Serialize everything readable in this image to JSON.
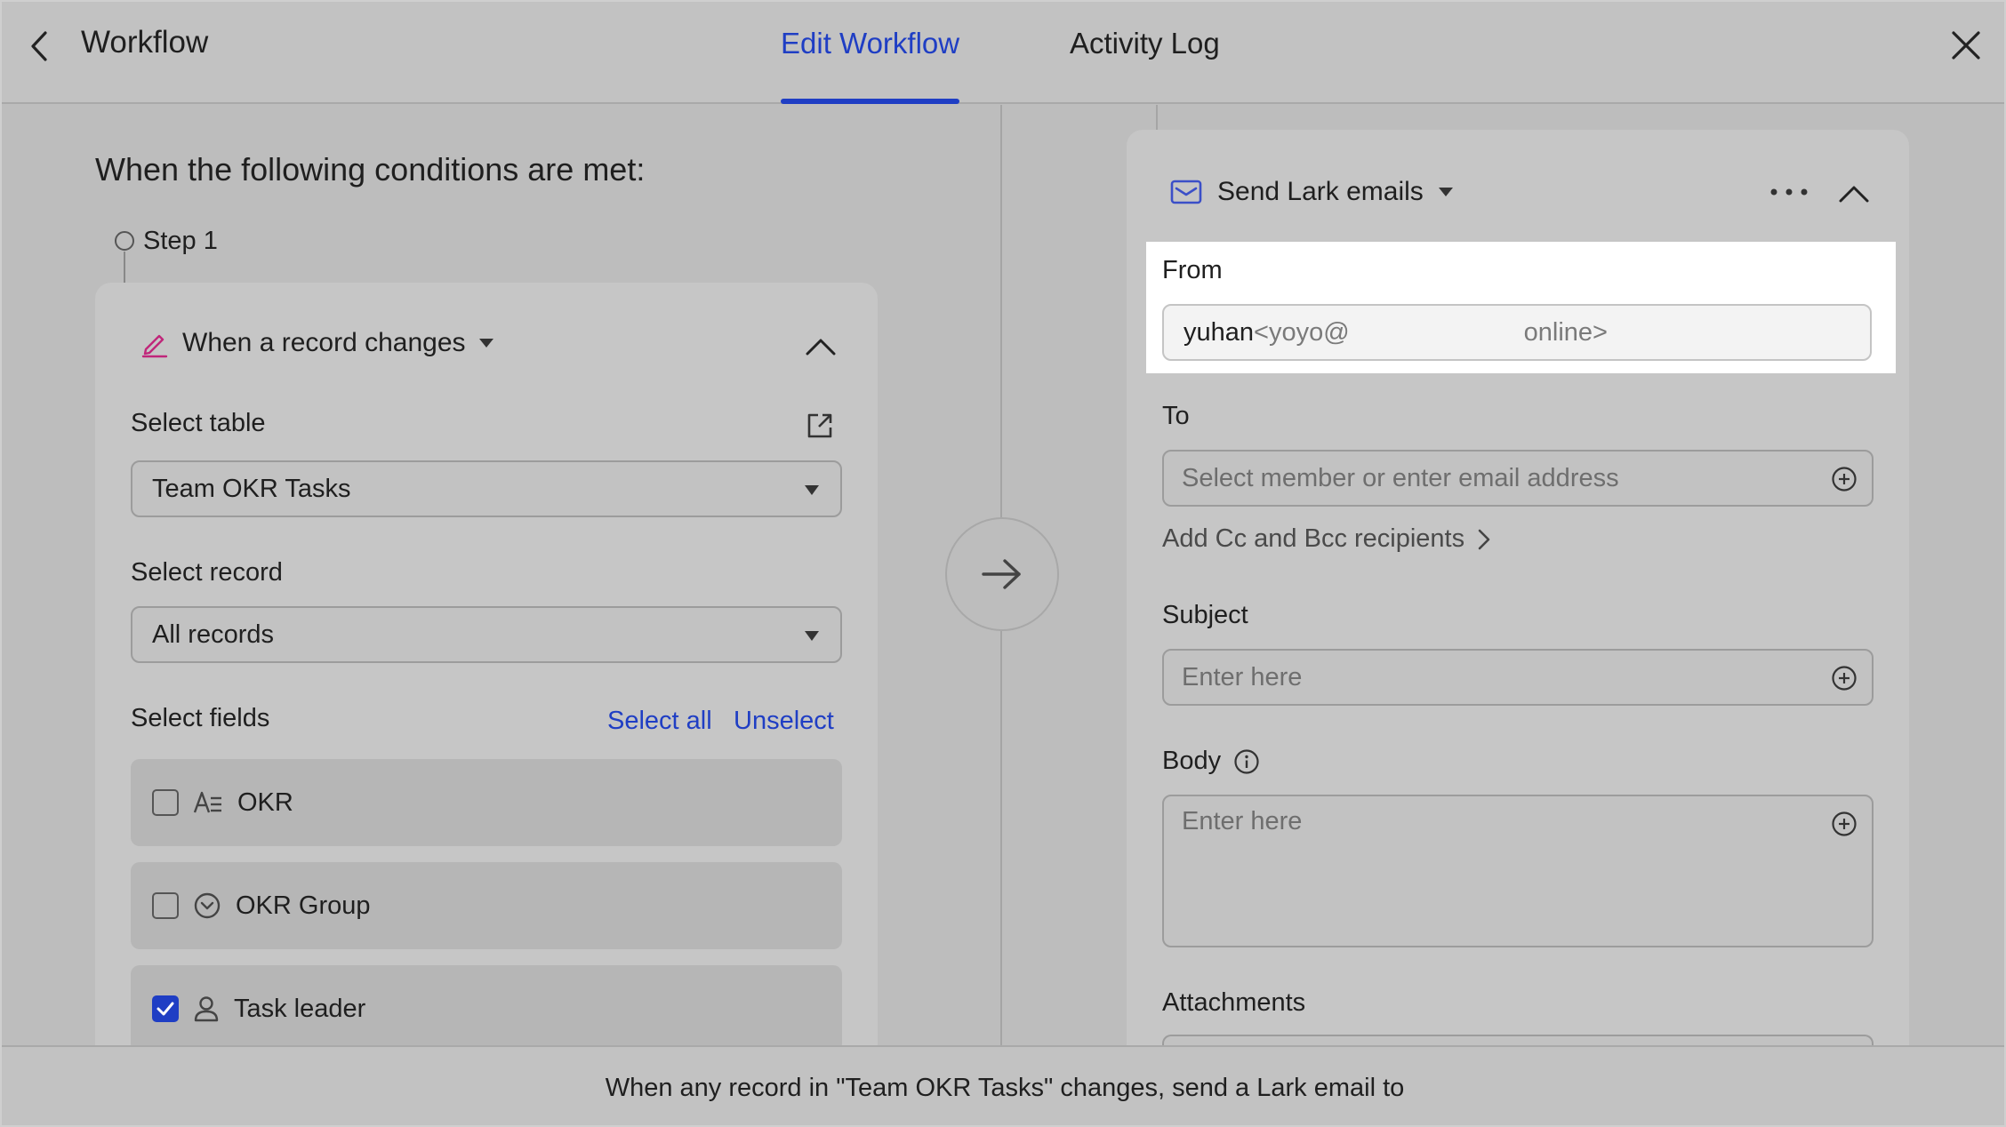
{
  "header": {
    "title": "Workflow",
    "tabs": [
      {
        "label": "Edit Workflow",
        "active": true
      },
      {
        "label": "Activity Log",
        "active": false
      }
    ]
  },
  "trigger": {
    "section_title": "When the following conditions are met:",
    "step_label": "Step 1",
    "type_label": "When a record changes",
    "select_table_label": "Select table",
    "table_value": "Team OKR Tasks",
    "select_record_label": "Select record",
    "record_value": "All records",
    "select_fields_label": "Select fields",
    "select_all_label": "Select all",
    "unselect_label": "Unselect",
    "fields": [
      {
        "name": "OKR",
        "checked": false,
        "icon": "text-field-icon"
      },
      {
        "name": "OKR Group",
        "checked": false,
        "icon": "single-select-icon"
      },
      {
        "name": "Task leader",
        "checked": true,
        "icon": "person-icon"
      }
    ]
  },
  "action": {
    "type_label": "Send Lark emails",
    "from_label": "From",
    "from_name": "yuhan",
    "from_address_start": "<yoyo@",
    "from_address_end": "online>",
    "to_label": "To",
    "to_placeholder": "Select member or enter email address",
    "add_cc_label": "Add Cc and Bcc recipients",
    "subject_label": "Subject",
    "subject_placeholder": "Enter here",
    "body_label": "Body",
    "body_placeholder": "Enter here",
    "attachments_label": "Attachments"
  },
  "footer": {
    "summary": "When any record in \"Team OKR Tasks\" changes, send a Lark email to"
  },
  "colors": {
    "accent": "#1f3ec4",
    "trigger_icon": "#c0267a",
    "mail_icon": "#3b4fc8"
  }
}
